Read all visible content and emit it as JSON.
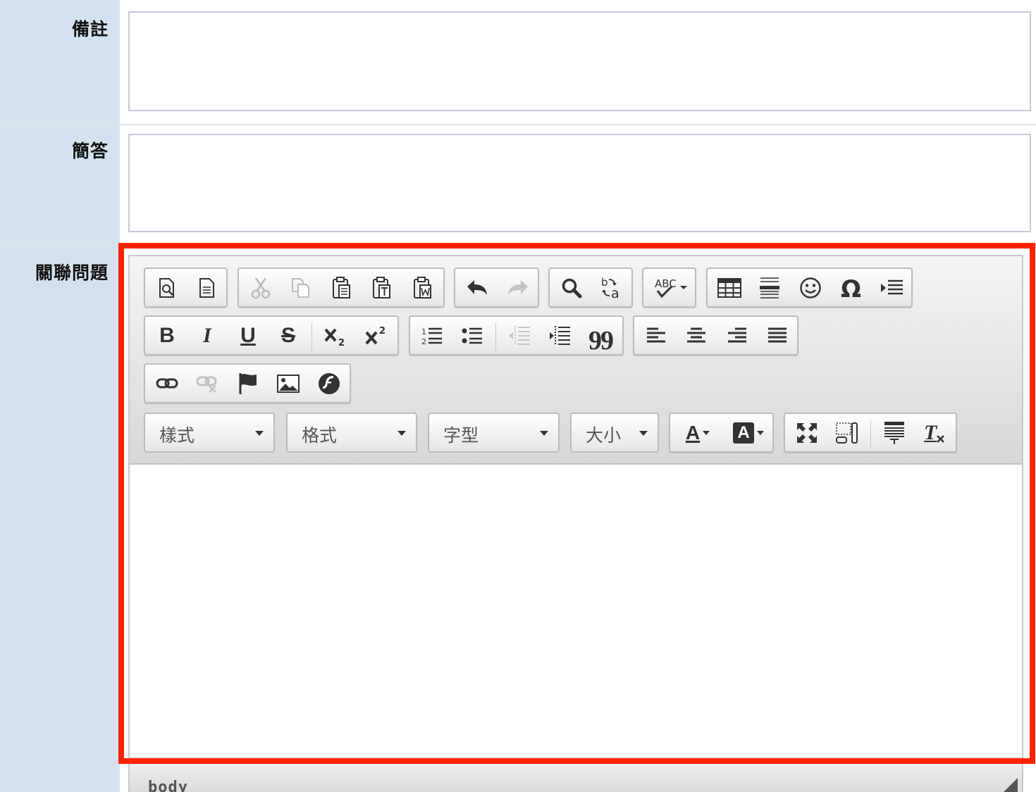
{
  "fields": {
    "remarks_label": "備註",
    "short_answer_label": "簡答",
    "related_questions_label": "關聯問題"
  },
  "editor": {
    "combos": {
      "styles": "樣式",
      "format": "格式",
      "font": "字型",
      "size": "大小"
    },
    "status_path": "body",
    "toolbar_text": {
      "bold": "B",
      "italic": "I",
      "underline": "U",
      "strike": "S",
      "blockquote": "99",
      "text_color": "A",
      "bg_color": "A"
    }
  },
  "colors": {
    "label_bg": "#d4e2ef",
    "highlight": "#ff2200",
    "field_border": "#c5cad9"
  }
}
